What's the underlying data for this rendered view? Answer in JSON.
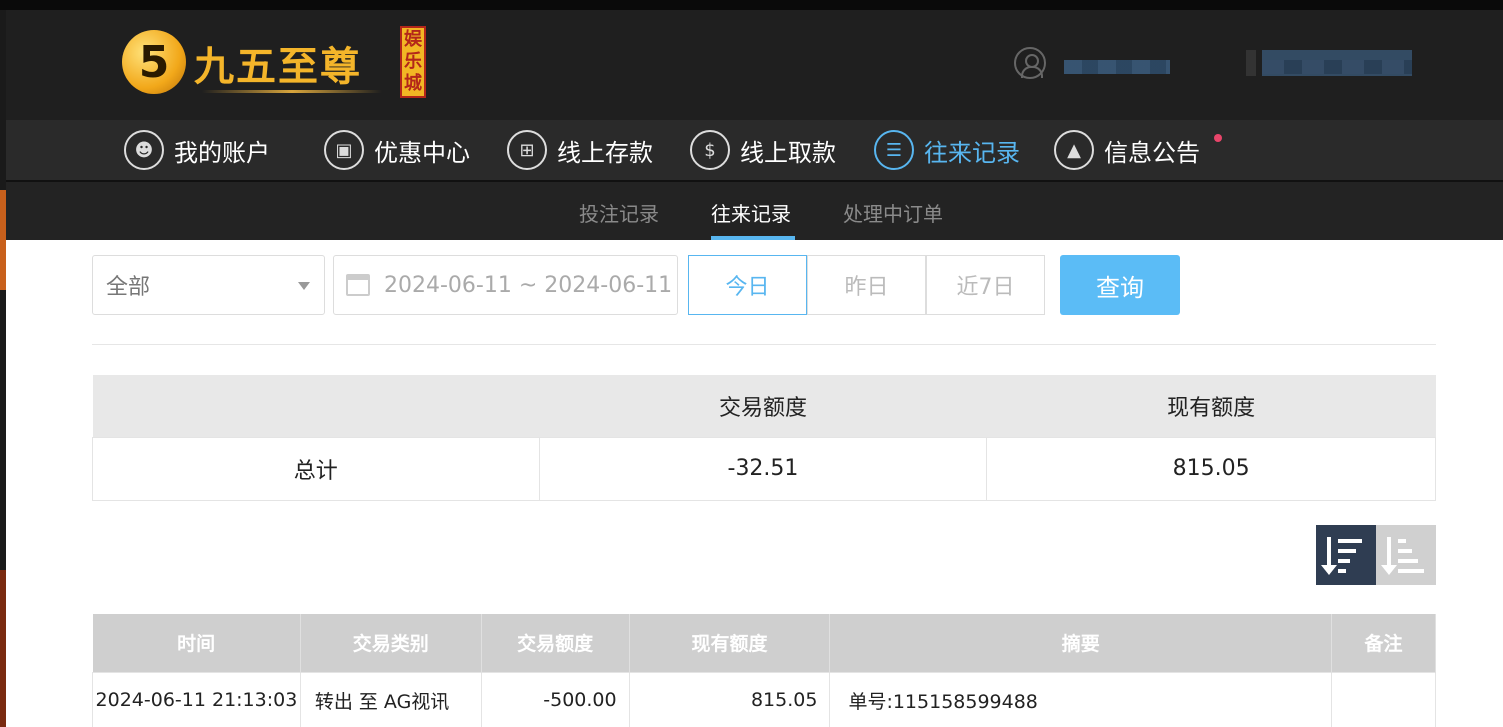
{
  "brand": {
    "logo_mark": "5",
    "name": "九五至尊",
    "badge": [
      "娱",
      "乐",
      "城"
    ]
  },
  "nav": {
    "items": [
      {
        "label": "我的账户",
        "icon": "user-icon"
      },
      {
        "label": "优惠中心",
        "icon": "gift-icon"
      },
      {
        "label": "线上存款",
        "icon": "deposit-icon"
      },
      {
        "label": "线上取款",
        "icon": "withdraw-icon"
      },
      {
        "label": "往来记录",
        "icon": "records-icon",
        "active": true
      },
      {
        "label": "信息公告",
        "icon": "bell-icon",
        "has_dot": true
      }
    ]
  },
  "subnav": {
    "items": [
      "投注记录",
      "往来记录",
      "处理中订单"
    ],
    "active": "往来记录"
  },
  "filters": {
    "type_select": "全部",
    "date_range": "2024-06-11 ~ 2024-06-11",
    "quick_ranges": [
      "今日",
      "昨日",
      "近7日"
    ],
    "active_range": "今日",
    "query_label": "查询"
  },
  "summary": {
    "headers": [
      "",
      "交易额度",
      "现有额度"
    ],
    "row": [
      "总计",
      "-32.51",
      "815.05"
    ]
  },
  "records": {
    "headers": [
      "时间",
      "交易类别",
      "交易额度",
      "现有额度",
      "摘要",
      "备注"
    ],
    "rows": [
      [
        "2024-06-11 21:13:03",
        "转出 至 AG视讯",
        "-500.00",
        "815.05",
        "单号:115158599488",
        ""
      ]
    ]
  },
  "colors": {
    "accent": "#58b6f0",
    "query_button": "#5bbcf6",
    "header_bg": "#1f1f1f",
    "notify_dot": "#e8456a"
  }
}
